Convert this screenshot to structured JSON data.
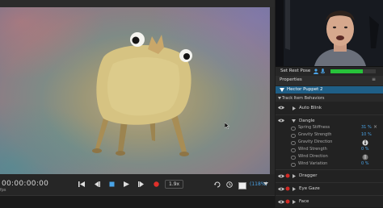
{
  "stage": {},
  "transport": {
    "timecode": "00:00:00:00",
    "fps": "fps",
    "speed": "1.9x",
    "zoom": "(118%)"
  },
  "webcam": {
    "rest_pose_label": "Set Rest Pose",
    "mic_level_fraction": 0.72
  },
  "properties": {
    "title": "Properties",
    "puppet": "Hector Puppet 2",
    "track_behaviors_label": "Track Item Behaviors",
    "behaviors": [
      {
        "name": "Auto Blink"
      },
      {
        "name": "Dangle",
        "expanded": true,
        "params": [
          {
            "label": "Spring Stiffness",
            "value": "31 %"
          },
          {
            "label": "Gravity Strength",
            "value": "10 %"
          },
          {
            "label": "Gravity Direction",
            "value": ""
          },
          {
            "label": "Wind Strength",
            "value": "0 %"
          },
          {
            "label": "Wind Direction",
            "value": ""
          },
          {
            "label": "Wind Variation",
            "value": "0 %"
          }
        ]
      },
      {
        "name": "Dragger"
      },
      {
        "name": "Eye Gaze"
      },
      {
        "name": "Face"
      }
    ]
  },
  "colors": {
    "accent": "#4aa4e8",
    "selection": "#1f5f87",
    "meter": "#27c23a",
    "record": "#e0302a"
  }
}
